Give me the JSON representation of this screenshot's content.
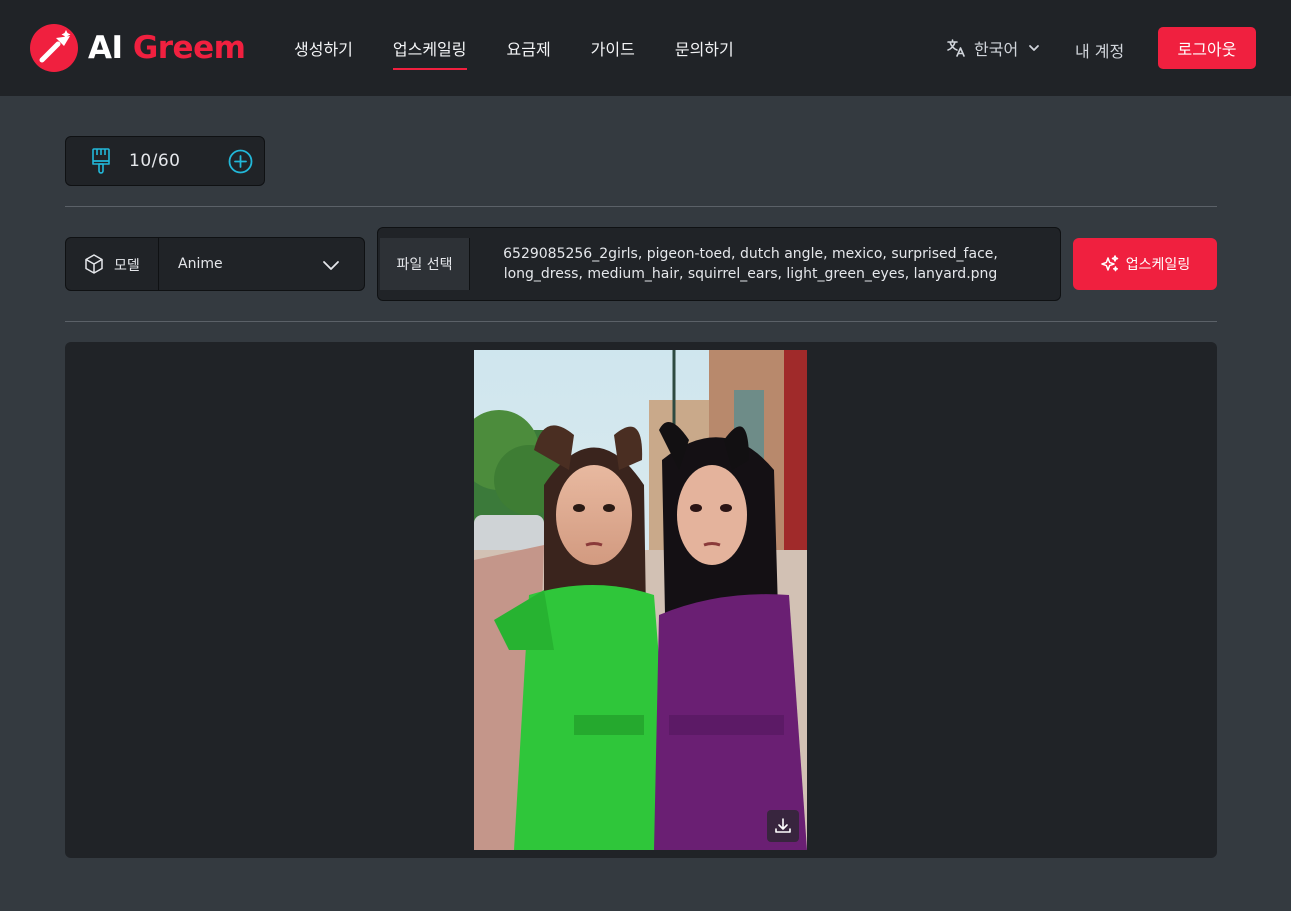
{
  "brand": {
    "name_part1": "AI",
    "name_part2": "Greem",
    "accent": "#f0203f"
  },
  "nav": {
    "items": [
      {
        "label": "생성하기",
        "active": false
      },
      {
        "label": "업스케일링",
        "active": true
      },
      {
        "label": "요금제",
        "active": false
      },
      {
        "label": "가이드",
        "active": false
      },
      {
        "label": "문의하기",
        "active": false
      }
    ]
  },
  "header": {
    "language": "한국어",
    "language_icon": "translate-icon",
    "account": "내 계정",
    "logout": "로그아웃"
  },
  "credits": {
    "value": "10/60",
    "icon": "brush-icon",
    "add_icon": "plus-circle-icon"
  },
  "model": {
    "label": "모델",
    "value": "Anime",
    "icon": "cube-icon"
  },
  "file": {
    "button": "파일 선택",
    "name_line1": "6529085256_2girls, pigeon-toed, dutch angle, mexico, surprised_face,",
    "name_line2": "long_dress, medium_hair, squirrel_ears, light_green_eyes, lanyard.png"
  },
  "upscale_button": {
    "label": "업스케일링",
    "icon": "sparkles-icon"
  },
  "preview": {
    "download_icon": "download-icon"
  }
}
